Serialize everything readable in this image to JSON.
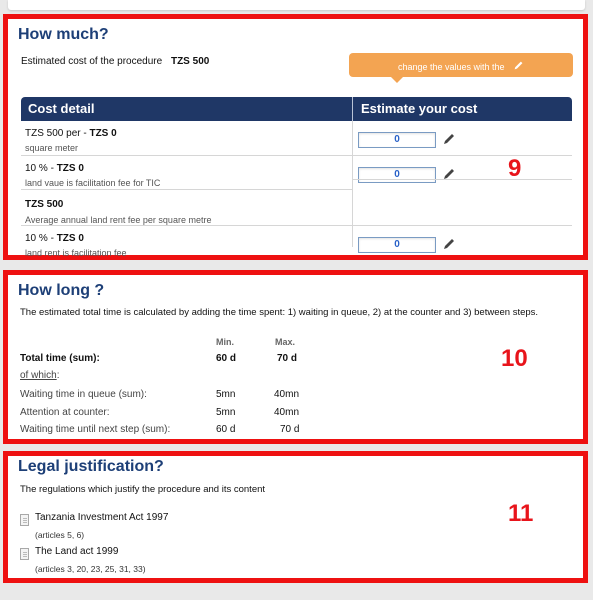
{
  "how_much": {
    "title": "How much?",
    "estimated_label": "Estimated cost of the procedure",
    "estimated_value": "TZS  500",
    "banner_text": "change the values with the",
    "col_cost_detail": "Cost detail",
    "col_estimate": "Estimate your cost",
    "rows": [
      {
        "main_prefix": "TZS  500 per  - ",
        "main_bold": "TZS 0",
        "sub": "square meter",
        "input": "0"
      },
      {
        "main_prefix": "10 % - ",
        "main_bold": "TZS 0",
        "sub": "land vaue is facilitation fee for TIC",
        "input": "0"
      },
      {
        "main_prefix": "",
        "main_bold": "TZS 500",
        "sub": "Average annual land rent fee per square metre",
        "input": ""
      },
      {
        "main_prefix": "10 % - ",
        "main_bold": "TZS 0",
        "sub": "land rent is facilitation fee",
        "input": "0"
      }
    ],
    "marker": "9"
  },
  "how_long": {
    "title": "How long ?",
    "description": "The estimated total time is calculated by adding the time spent: 1) waiting in queue, 2) at the counter and 3) between steps.",
    "col_min": "Min.",
    "col_max": "Max.",
    "total_label": "Total time (sum):",
    "total_min": "60 d",
    "total_max": "70 d",
    "of_which": "of which",
    "of_which_colon": ":",
    "rows": [
      {
        "label": "Waiting time in queue (sum):",
        "min": "5mn",
        "max": "40mn"
      },
      {
        "label": "Attention at counter:",
        "min": "5mn",
        "max": "40mn"
      },
      {
        "label": "Waiting time until next step (sum):",
        "min": "60 d",
        "max": "70 d"
      }
    ],
    "marker": "10"
  },
  "legal": {
    "title": "Legal justification?",
    "description": "The regulations which justify the procedure and its content",
    "items": [
      {
        "name": "Tanzania Investment Act 1997",
        "articles": "(articles 5, 6)"
      },
      {
        "name": "The Land act 1999",
        "articles": "(articles 3, 20, 23, 25, 31, 33)"
      }
    ],
    "marker": "11"
  },
  "colors": {
    "highlight": "#ee1111",
    "heading": "#1d3f77",
    "table_header": "#1f3766",
    "banner": "#f3a452",
    "input_value": "#2a62c8"
  },
  "icons": [
    "pencil-icon",
    "document-icon"
  ]
}
